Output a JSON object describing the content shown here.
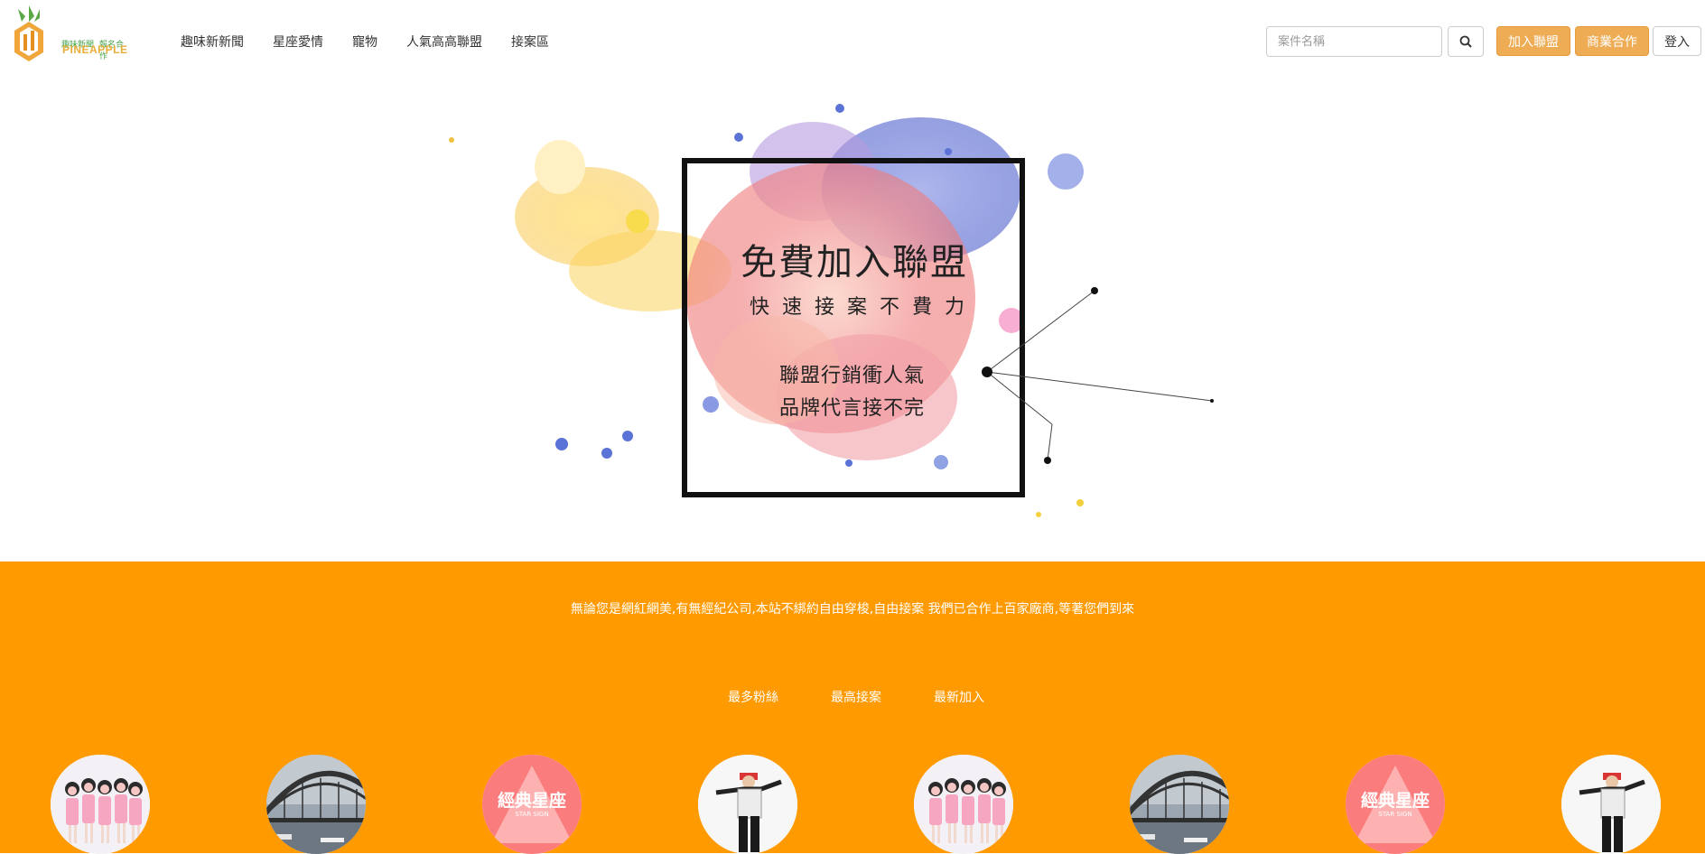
{
  "header": {
    "logo_tag_left": "趣味新聞",
    "logo_tag_right": "報名合作",
    "logo_word": "PINEAPPLE",
    "nav": [
      "趣味新新聞",
      "星座愛情",
      "寵物",
      "人氣高高聯盟",
      "接案區"
    ],
    "search_placeholder": "案件名稱",
    "join_label": "加入聯盟",
    "biz_label": "商業合作",
    "login_label": "登入"
  },
  "hero": {
    "title": "免費加入聯盟",
    "subtitle": "快速接案不費力",
    "line1": "聯盟行銷衝人氣",
    "line2": "品牌代言接不完"
  },
  "band": {
    "text": "無論您是網紅網美,有無經紀公司,本站不綁約自由穿梭,自由接案  我們已合作上百家廠商,等著您們到來",
    "tabs": [
      "最多粉絲",
      "最高接案",
      "最新加入"
    ],
    "starsign_title": "經典星座",
    "starsign_sub": "STAR SIGN",
    "avatars": [
      "girls-group",
      "bridge",
      "star-sign",
      "dancer",
      "girls-group",
      "bridge",
      "star-sign",
      "dancer"
    ]
  },
  "colors": {
    "accent_orange": "#ff9a00",
    "button_orange": "#eeac54"
  }
}
